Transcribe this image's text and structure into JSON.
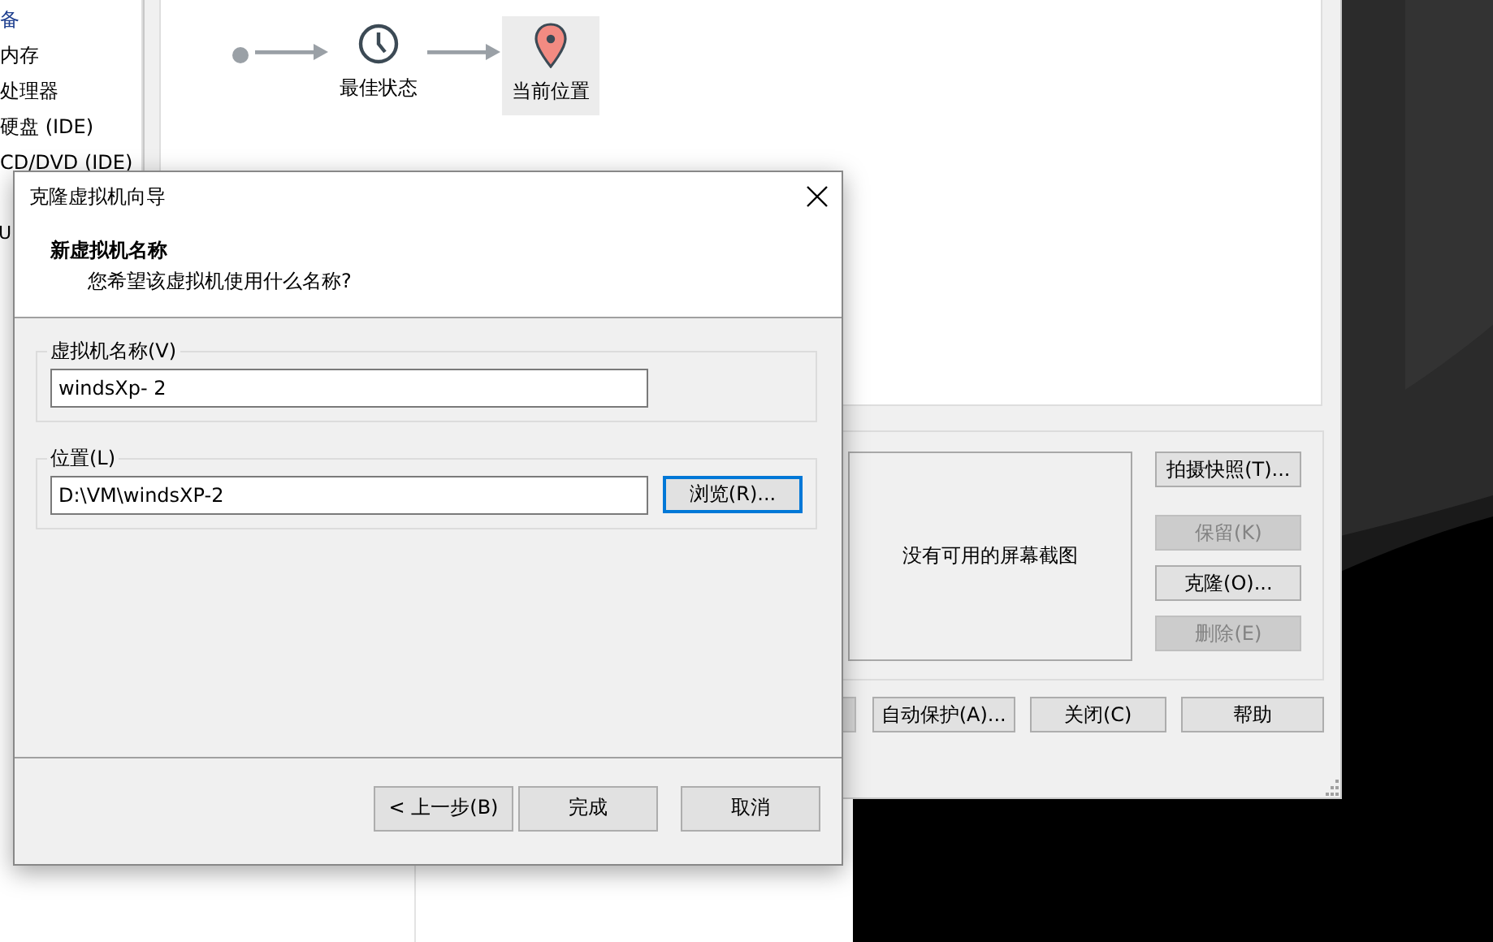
{
  "device_sidebar": {
    "items": [
      {
        "label": "备",
        "kind": "header"
      },
      {
        "label": "内存",
        "kind": "item"
      },
      {
        "label": "处理器",
        "kind": "item"
      },
      {
        "label": "硬盘 (IDE)",
        "kind": "item"
      },
      {
        "label": "CD/DVD (IDE)",
        "kind": "item"
      },
      {
        "label": "U",
        "kind": "clipped"
      }
    ]
  },
  "snapshot_tree": {
    "nodes": [
      {
        "label": "最佳状态",
        "kind": "snapshot",
        "selected": false
      },
      {
        "label": "当前位置",
        "kind": "current",
        "selected": true
      }
    ]
  },
  "screenshot_panel": {
    "message": "没有可用的屏幕截图"
  },
  "snapshot_buttons": [
    {
      "label": "拍摄快照(T)...",
      "disabled": false
    },
    {
      "label": "保留(K)",
      "disabled": true
    },
    {
      "label": "克隆(O)...",
      "disabled": false
    },
    {
      "label": "删除(E)",
      "disabled": true
    }
  ],
  "footer_buttons": [
    {
      "label": "自动保护(A)..."
    },
    {
      "label": "关闭(C)"
    },
    {
      "label": "帮助"
    }
  ],
  "dialog": {
    "title": "克隆虚拟机向导",
    "heading": "新虚拟机名称",
    "subheading": "您希望该虚拟机使用什么名称?",
    "fields": [
      {
        "label": "虚拟机名称(V)",
        "value": "windsXp- 2"
      },
      {
        "label": "位置(L)",
        "value": "D:\\VM\\windsXP-2",
        "button": {
          "label": "浏览(R)...",
          "focused": true
        }
      }
    ],
    "buttons": [
      {
        "label": "< 上一步(B)"
      },
      {
        "label": "完成"
      },
      {
        "label": "取消"
      }
    ]
  }
}
